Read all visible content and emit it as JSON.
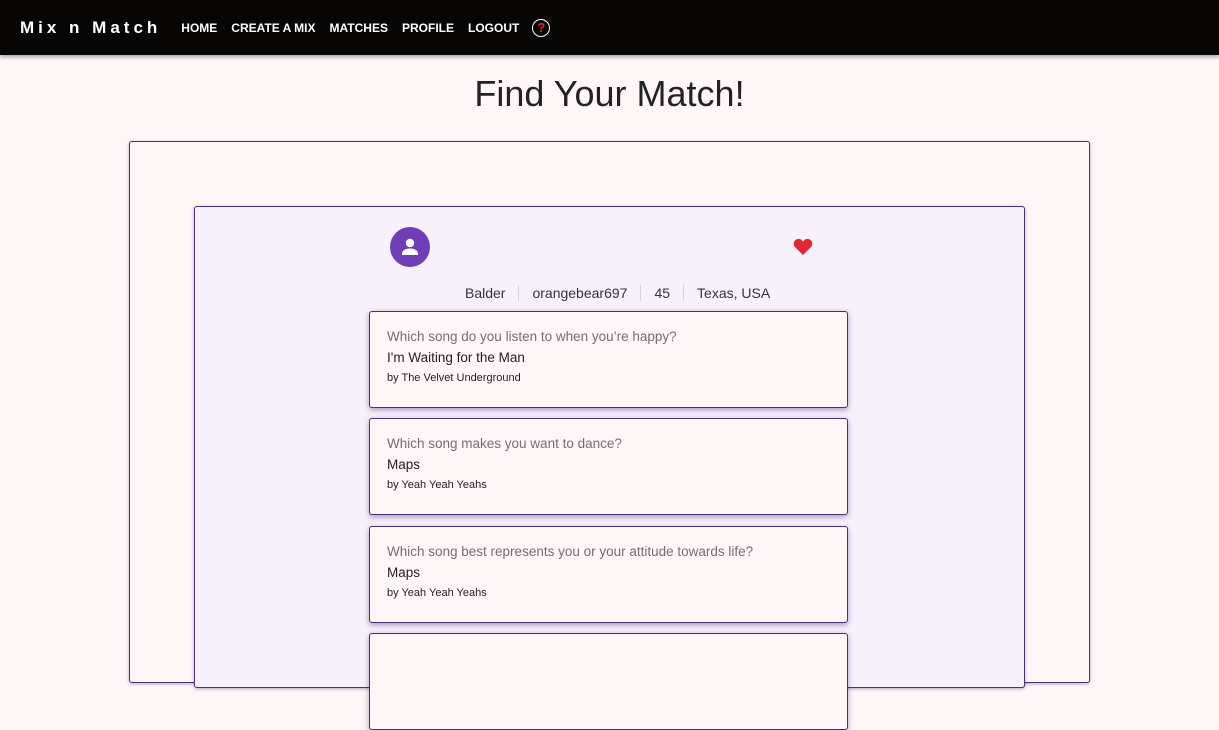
{
  "nav": {
    "brand": "Mix n Match",
    "links": [
      "HOME",
      "CREATE A MIX",
      "MATCHES",
      "PROFILE",
      "LOGOUT"
    ],
    "help_icon": "question-circle-icon",
    "help_glyph": "?"
  },
  "page": {
    "title": "Find Your Match!"
  },
  "profile": {
    "avatar_icon": "person-icon",
    "favorite_icon": "heart-icon",
    "name": "Balder",
    "username": "orangebear697",
    "age": "45",
    "location": "Texas, USA"
  },
  "answers": [
    {
      "question": "Which song do you listen to when you’re happy?",
      "song": "I'm Waiting for the Man",
      "artist": "by The Velvet Underground"
    },
    {
      "question": "Which song makes you want to dance?",
      "song": "Maps",
      "artist": "by Yeah Yeah Yeahs"
    },
    {
      "question": "Which song best represents you or your attitude towards life?",
      "song": "Maps",
      "artist": "by Yeah Yeah Yeahs"
    },
    {
      "question": "",
      "song": "",
      "artist": ""
    }
  ],
  "colors": {
    "navbar": "#080604",
    "page_background": "#fff6f7",
    "accent_purple": "#6f3db5",
    "border_purple": "#4a2f7a",
    "heart_red": "#e32636"
  }
}
